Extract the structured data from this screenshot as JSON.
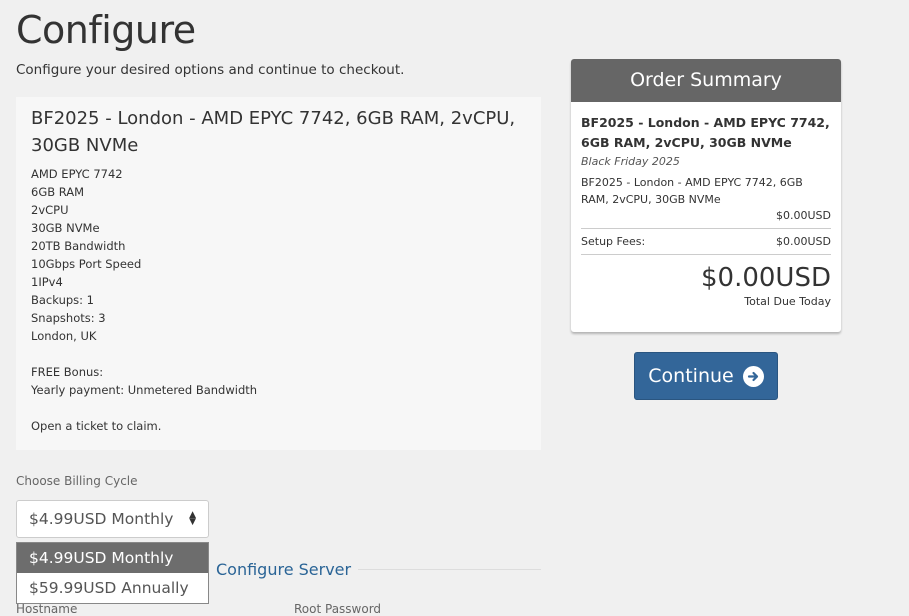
{
  "page": {
    "title": "Configure",
    "subtitle": "Configure your desired options and continue to checkout."
  },
  "product": {
    "name": "BF2025 - London - AMD EPYC 7742, 6GB RAM, 2vCPU, 30GB NVMe",
    "description_lines": [
      "AMD EPYC 7742",
      "6GB RAM",
      "2vCPU",
      "30GB NVMe",
      "20TB Bandwidth",
      "10Gbps Port Speed",
      "1IPv4",
      "Backups: 1",
      "Snapshots: 3",
      "London, UK",
      "",
      "FREE Bonus:",
      "Yearly payment: Unmetered Bandwidth",
      "",
      "Open a ticket to claim."
    ]
  },
  "billing": {
    "label": "Choose Billing Cycle",
    "selected": "$4.99USD Monthly",
    "options": [
      "$4.99USD Monthly",
      "$59.99USD Annually"
    ]
  },
  "configure_server": {
    "heading": "Configure Server",
    "hostname_label": "Hostname",
    "root_password_label": "Root Password"
  },
  "order_summary": {
    "header": "Order Summary",
    "product_name": "BF2025 - London - AMD EPYC 7742, 6GB RAM, 2vCPU, 30GB NVMe",
    "product_group": "Black Friday 2025",
    "line_item": "BF2025 - London - AMD EPYC 7742, 6GB RAM, 2vCPU, 30GB NVMe",
    "line_price": "$0.00USD",
    "setup_fees_label": "Setup Fees:",
    "setup_fees_value": "$0.00USD",
    "total": "$0.00USD",
    "total_label": "Total Due Today"
  },
  "actions": {
    "continue_label": "Continue",
    "continue_icon": "arrow-circle-right-icon"
  },
  "colors": {
    "accent": "#336699",
    "summary_header": "#666666",
    "link": "#2a6496"
  }
}
